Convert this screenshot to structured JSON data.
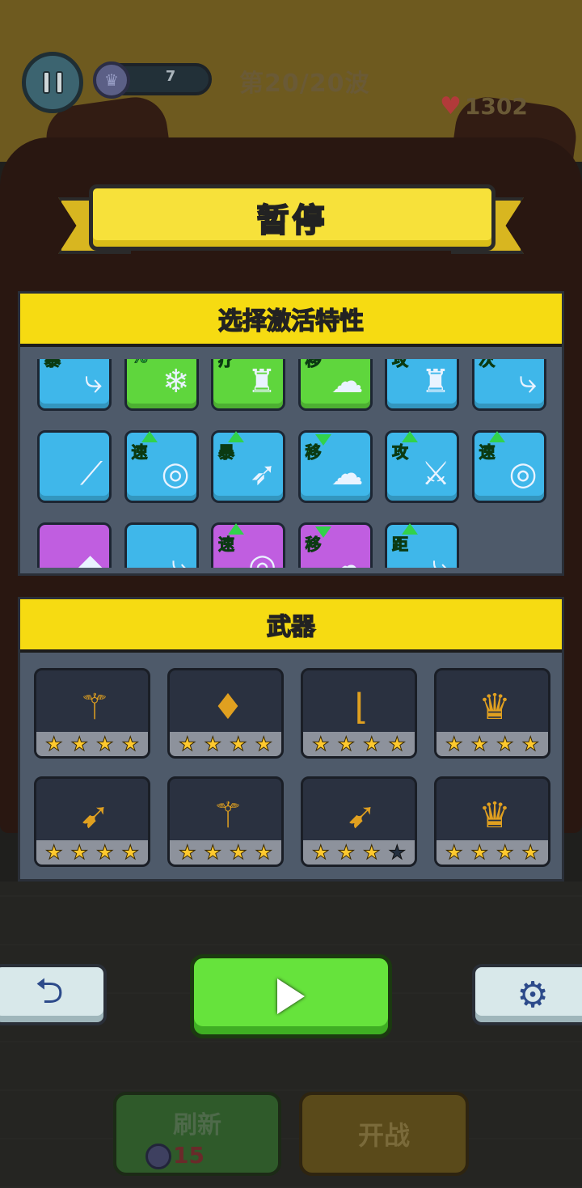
{
  "hud": {
    "coins": "7",
    "wave": "第20/20波",
    "hp": "1302"
  },
  "dialog": {
    "title": "暂停"
  },
  "traits_panel": {
    "title": "选择激活特性",
    "items": [
      {
        "tag": "暴",
        "color": "blue",
        "icon": "boomerang-icon",
        "arrow": "up"
      },
      {
        "tag": "%",
        "color": "green",
        "icon": "ice-slime-icon",
        "arrow": "up"
      },
      {
        "tag": "疗",
        "color": "green",
        "icon": "cloak-icon",
        "arrow": "up"
      },
      {
        "tag": "移",
        "color": "green",
        "icon": "slime-icon",
        "arrow": "down"
      },
      {
        "tag": "攻",
        "color": "blue",
        "icon": "cloak-icon",
        "arrow": "up"
      },
      {
        "tag": "次",
        "color": "blue",
        "icon": "boomerang-icon",
        "arrow": "up"
      },
      {
        "tag": "",
        "color": "blue",
        "icon": "chain-whip-icon",
        "arrow": ""
      },
      {
        "tag": "速",
        "color": "blue",
        "icon": "ring-icon",
        "arrow": "up"
      },
      {
        "tag": "暴",
        "color": "blue",
        "icon": "arrow-icon",
        "arrow": "up"
      },
      {
        "tag": "移",
        "color": "blue",
        "icon": "slime-icon",
        "arrow": "down"
      },
      {
        "tag": "攻",
        "color": "blue",
        "icon": "sword-icon",
        "arrow": "up"
      },
      {
        "tag": "速",
        "color": "blue",
        "icon": "ring-icon",
        "arrow": "up"
      },
      {
        "tag": "",
        "color": "purple",
        "icon": "shards-icon",
        "arrow": ""
      },
      {
        "tag": "",
        "color": "blue",
        "icon": "boomerang-icon",
        "arrow": ""
      },
      {
        "tag": "速",
        "color": "purple",
        "icon": "ring-icon",
        "arrow": "up"
      },
      {
        "tag": "移",
        "color": "purple",
        "icon": "slime-icon",
        "arrow": "down"
      },
      {
        "tag": "距",
        "color": "blue",
        "icon": "boomerang-icon",
        "arrow": "up"
      }
    ]
  },
  "weapons_panel": {
    "title": "武器",
    "items": [
      {
        "icon": "scepter-icon",
        "stars": 4
      },
      {
        "icon": "robe-icon",
        "stars": 4
      },
      {
        "icon": "boomerang-icon",
        "stars": 4
      },
      {
        "icon": "crown-icon",
        "stars": 4
      },
      {
        "icon": "crossbow-icon",
        "stars": 4
      },
      {
        "icon": "scepter-icon",
        "stars": 4
      },
      {
        "icon": "crossbow-icon",
        "stars": 3
      },
      {
        "icon": "crown-icon",
        "stars": 4
      }
    ]
  },
  "buttons": {
    "refresh_label": "刷新",
    "refresh_cost": "15",
    "battle_label": "开战"
  },
  "colors": {
    "banner": "#f7e13a",
    "play": "#66e33c",
    "panel": "#4e5a6a"
  }
}
